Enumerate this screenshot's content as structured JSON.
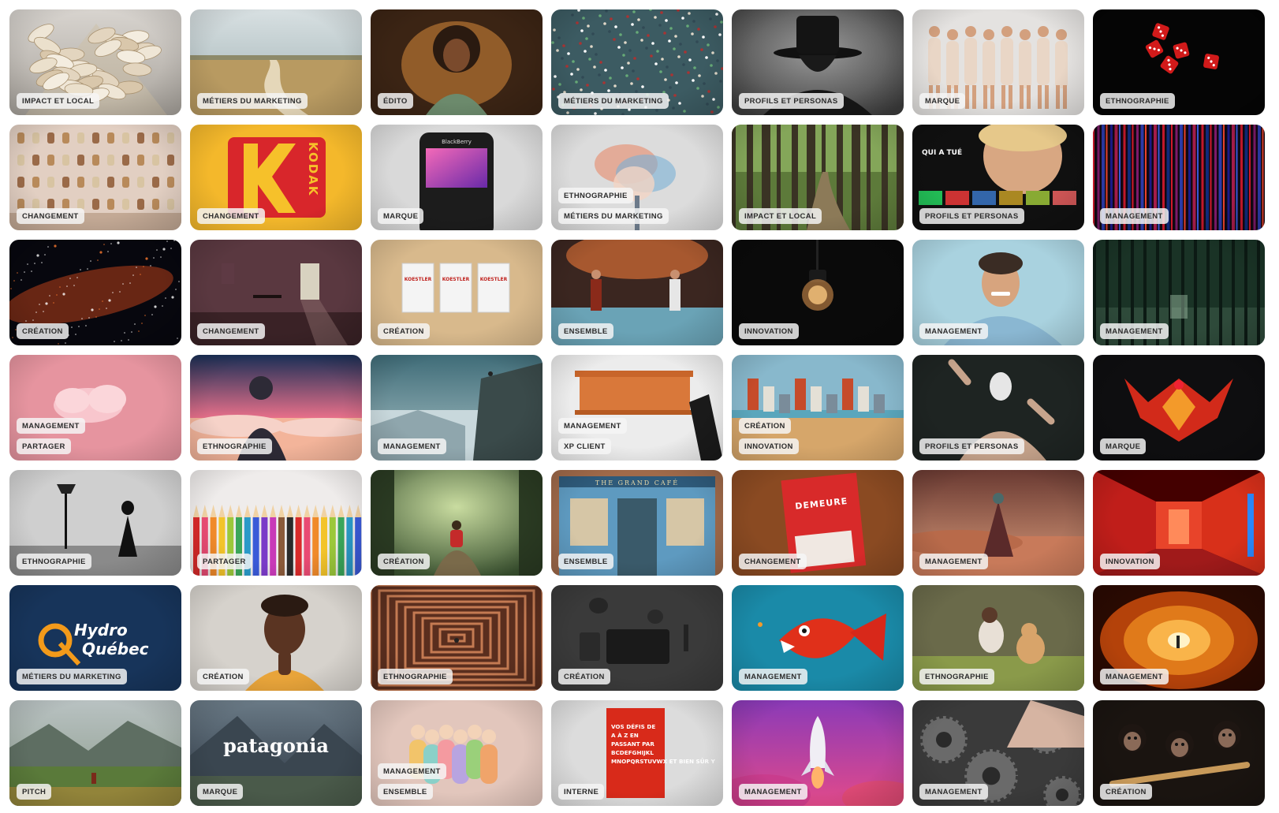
{
  "cards": [
    {
      "name": "sneakers-pile",
      "tags": [
        "Impact et local"
      ],
      "art": "sneakers"
    },
    {
      "name": "country-road",
      "tags": [
        "Métiers du marketing"
      ],
      "art": "road"
    },
    {
      "name": "woman-books",
      "tags": [
        "Édito"
      ],
      "art": "woman"
    },
    {
      "name": "crowd-aerial",
      "tags": [
        "Métiers du marketing"
      ],
      "art": "crowd"
    },
    {
      "name": "hat-silhouette",
      "tags": [
        "Profils et personas"
      ],
      "art": "hat"
    },
    {
      "name": "women-group",
      "tags": [
        "Marque"
      ],
      "art": "women"
    },
    {
      "name": "red-dice",
      "tags": [
        "Ethnographie"
      ],
      "art": "dice"
    },
    {
      "name": "trophy-wall",
      "tags": [
        "Changement"
      ],
      "art": "trophies"
    },
    {
      "name": "kodak-logo",
      "tags": [
        "Changement"
      ],
      "art": "kodak",
      "text": "KODAK"
    },
    {
      "name": "blackberry-phone",
      "tags": [
        "Marque"
      ],
      "art": "phone",
      "text": "BlackBerry"
    },
    {
      "name": "colored-smoke",
      "tags": [
        "Ethnographie",
        "Métiers du marketing"
      ],
      "art": "smoke"
    },
    {
      "name": "forest-path",
      "tags": [
        "Impact et local"
      ],
      "art": "forest"
    },
    {
      "name": "streaming-ui",
      "tags": [
        "Profils et personas"
      ],
      "art": "netflix",
      "text": "QUI A TUÉ"
    },
    {
      "name": "color-stripes",
      "tags": [
        "Management"
      ],
      "art": "stripes"
    },
    {
      "name": "galaxy",
      "tags": [
        "Création"
      ],
      "art": "galaxy"
    },
    {
      "name": "dark-room",
      "tags": [
        "Changement"
      ],
      "art": "room"
    },
    {
      "name": "koestler-books",
      "tags": [
        "Création"
      ],
      "art": "books",
      "text": "KOESTLER"
    },
    {
      "name": "fighters-scene",
      "tags": [
        "Ensemble"
      ],
      "art": "fighters"
    },
    {
      "name": "light-bulb",
      "tags": [
        "Innovation"
      ],
      "art": "bulb"
    },
    {
      "name": "smiling-man",
      "tags": [
        "Management"
      ],
      "art": "man"
    },
    {
      "name": "reflective-forest",
      "tags": [
        "Management"
      ],
      "art": "darkforest"
    },
    {
      "name": "pink-cloud",
      "tags": [
        "Management",
        "Partager"
      ],
      "art": "cloud"
    },
    {
      "name": "child-sky",
      "tags": [
        "Ethnographie"
      ],
      "art": "child"
    },
    {
      "name": "cliff-climber",
      "tags": [
        "Management"
      ],
      "art": "cliff"
    },
    {
      "name": "wooden-shelf",
      "tags": [
        "Management",
        "XP client"
      ],
      "art": "shelf"
    },
    {
      "name": "surreal-city",
      "tags": [
        "Création",
        "Innovation"
      ],
      "art": "surreal"
    },
    {
      "name": "masked-figure",
      "tags": [
        "Profils et personas"
      ],
      "art": "mask"
    },
    {
      "name": "red-phoenix",
      "tags": [
        "Marque"
      ],
      "art": "phoenix"
    },
    {
      "name": "photo-studio",
      "tags": [
        "Ethnographie"
      ],
      "art": "studio"
    },
    {
      "name": "color-pencils",
      "tags": [
        "Partager"
      ],
      "art": "pencils"
    },
    {
      "name": "girl-forest",
      "tags": [
        "Création"
      ],
      "art": "girlforest"
    },
    {
      "name": "grand-cafe",
      "tags": [
        "Ensemble"
      ],
      "art": "cafe",
      "text": "THE GRAND CAFÉ"
    },
    {
      "name": "demeure-book",
      "tags": [
        "Changement"
      ],
      "art": "demeure",
      "text": "DEMEURE"
    },
    {
      "name": "desert-figure",
      "tags": [
        "Management"
      ],
      "art": "desert"
    },
    {
      "name": "neon-corridor",
      "tags": [
        "Innovation"
      ],
      "art": "corridor"
    },
    {
      "name": "hydro-quebec",
      "tags": [
        "Métiers du marketing"
      ],
      "art": "hydro",
      "text": "Hydro\nQuébec"
    },
    {
      "name": "thinking-woman",
      "tags": [
        "Création"
      ],
      "art": "thinker"
    },
    {
      "name": "maze",
      "tags": [
        "Ethnographie"
      ],
      "art": "maze"
    },
    {
      "name": "desk-flatlay",
      "tags": [
        "Création"
      ],
      "art": "desk"
    },
    {
      "name": "red-fish",
      "tags": [
        "Management"
      ],
      "art": "fish"
    },
    {
      "name": "woman-dog",
      "tags": [
        "Ethnographie"
      ],
      "art": "dog"
    },
    {
      "name": "orange-tunnel",
      "tags": [
        "Management"
      ],
      "art": "tunnel"
    },
    {
      "name": "mountain-valley",
      "tags": [
        "Pitch"
      ],
      "art": "valley"
    },
    {
      "name": "patagonia",
      "tags": [
        "Marque"
      ],
      "art": "patagonia",
      "text": "patagonia"
    },
    {
      "name": "clay-crowd",
      "tags": [
        "Management",
        "Ensemble"
      ],
      "art": "clay"
    },
    {
      "name": "red-book",
      "tags": [
        "Interne"
      ],
      "art": "redbook",
      "text": "VOS DÉFIS DE A À Z EN PASSANT PAR BCDEFGHIJKL MNOPQRSTUVWX ET BIEN SÛR Y"
    },
    {
      "name": "rocket-launch",
      "tags": [
        "Management"
      ],
      "art": "rocket"
    },
    {
      "name": "gears-hand",
      "tags": [
        "Management"
      ],
      "art": "gears"
    },
    {
      "name": "chimpanzees",
      "tags": [
        "Création"
      ],
      "art": "chimps"
    }
  ]
}
